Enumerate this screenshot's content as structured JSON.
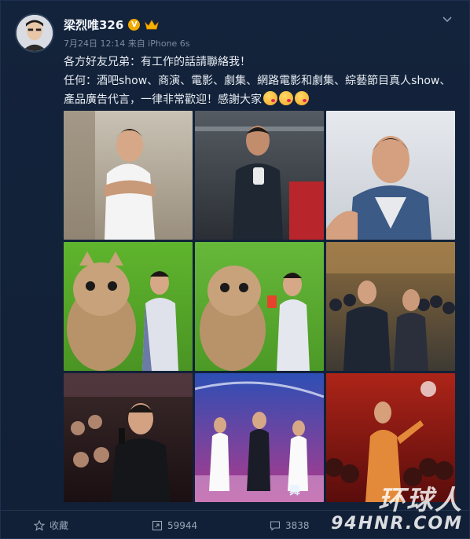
{
  "post": {
    "username": "梁烈唯326",
    "verified_badge": "V",
    "meta": "7月24日 12:14 来自 iPhone 6s",
    "text_line1": "各方好友兄弟：有工作的話請聯絡我！",
    "text_line2": "任何：酒吧show、商演、電影、劇集、網路電影和劇集、綜藝節目真人show、產品廣告代言，一律非常歡迎！感謝大家",
    "emoji_icon": "kiss-emoji-icon",
    "photos": [
      {
        "subject": "white-vest-portrait"
      },
      {
        "subject": "gym-mirror-selfie"
      },
      {
        "subject": "denim-vest-selfie"
      },
      {
        "subject": "furry-mascot-green-screen"
      },
      {
        "subject": "furry-mascot-green-screen-2"
      },
      {
        "subject": "crowd-event"
      },
      {
        "subject": "nightclub-singing"
      },
      {
        "subject": "stage-dance"
      },
      {
        "subject": "red-club-performance"
      }
    ]
  },
  "actions": {
    "favorite_label": "收藏",
    "repost_count": "59944",
    "comment_count": "3838"
  },
  "watermark": {
    "cn": "环球人",
    "en": "94HNR.COM"
  },
  "colors": {
    "background": "#112036",
    "accent_badge": "#f2a900"
  }
}
